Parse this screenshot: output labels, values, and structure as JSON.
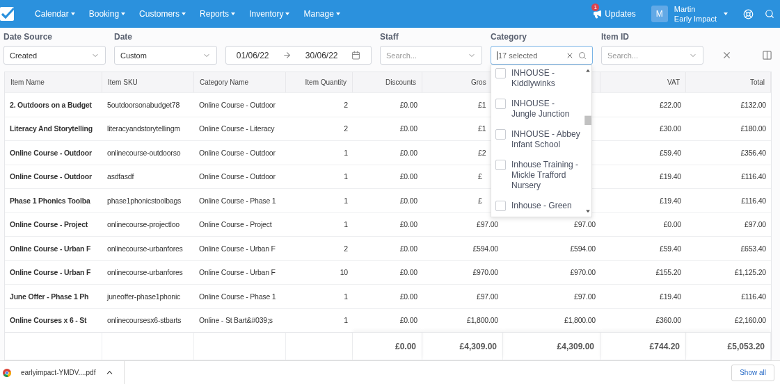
{
  "nav": {
    "menus": [
      "Calendar",
      "Booking",
      "Customers",
      "Reports",
      "Inventory",
      "Manage"
    ],
    "updates": {
      "label": "Updates",
      "badge": "1"
    },
    "user": {
      "avatar": "M",
      "name": "Martin",
      "org": "Early Impact"
    }
  },
  "filters": {
    "date_source": {
      "label": "Date Source",
      "value": "Created"
    },
    "date": {
      "label": "Date",
      "value": "Custom"
    },
    "range": {
      "from": "01/06/22",
      "to": "30/06/22"
    },
    "staff": {
      "label": "Staff",
      "placeholder": "Search..."
    },
    "category": {
      "label": "Category",
      "value": "17 selected",
      "options": [
        {
          "label": "INHOUSE - Kiddlywinks",
          "checked": false
        },
        {
          "label": "INHOUSE - Jungle Junction",
          "checked": false
        },
        {
          "label": "INHOUSE - Abbey Infant School",
          "checked": false
        },
        {
          "label": "Inhouse Training - Mickle Trafford Nursery",
          "checked": false
        },
        {
          "label": "Inhouse - Green",
          "checked": false
        }
      ]
    },
    "item_id": {
      "label": "Item ID",
      "placeholder": "Search..."
    }
  },
  "table": {
    "columns": [
      {
        "label": "Item Name",
        "covered": false
      },
      {
        "label": "Item SKU",
        "covered": false
      },
      {
        "label": "Category Name",
        "covered": false
      },
      {
        "label": "Item Quantity",
        "covered": false
      },
      {
        "label": "Discounts",
        "covered": false
      },
      {
        "label": "Gros",
        "covered": true
      },
      null,
      {
        "label": "VAT",
        "covered": false
      },
      {
        "label": "Total",
        "covered": false
      }
    ],
    "rows": [
      {
        "cells": [
          "2. Outdoors on a Budget",
          "5outdoorsonabudget78",
          "Online Course - Outdoor",
          "2",
          "£0.00",
          {
            "text": "£1",
            "covered": true
          },
          null,
          "£22.00",
          "£132.00"
        ]
      },
      {
        "cells": [
          "Literacy And Storytelling",
          "literacyandstorytellingm",
          "Online Course - Literacy",
          "2",
          "£0.00",
          {
            "text": "£1",
            "covered": true
          },
          null,
          "£30.00",
          "£180.00"
        ]
      },
      {
        "cells": [
          "Online Course - Outdoor",
          "onlinecourse-outdoorso",
          "Online Course - Outdoor",
          "1",
          "£0.00",
          {
            "text": "£2",
            "covered": true
          },
          null,
          "£59.40",
          "£356.40"
        ]
      },
      {
        "cells": [
          "Online Course - Outdoor",
          "asdfasdf",
          "Online Course - Outdoor",
          "1",
          "£0.00",
          {
            "text": "£",
            "covered": true
          },
          null,
          "£19.40",
          "£116.40"
        ]
      },
      {
        "cells": [
          "Phase 1 Phonics Toolba",
          "phase1phonicstoolbags",
          "Online Course - Phase 1",
          "1",
          "£0.00",
          {
            "text": "£",
            "covered": true
          },
          null,
          "£19.40",
          "£116.40"
        ]
      },
      {
        "cells": [
          "Online Course - Project",
          "onlinecourse-projectloo",
          "Online Course - Project",
          "1",
          "£0.00",
          {
            "text": "£97.00",
            "covered": false
          },
          "£97.00",
          "£0.00",
          "£97.00"
        ]
      },
      {
        "cells": [
          "Online Course - Urban F",
          "onlinecourse-urbanfores",
          "Online Course - Urban F",
          "2",
          "£0.00",
          {
            "text": "£594.00",
            "covered": false
          },
          "£594.00",
          "£59.40",
          "£653.40"
        ]
      },
      {
        "cells": [
          "Online Course - Urban F",
          "onlinecourse-urbanfores",
          "Online Course - Urban F",
          "10",
          "£0.00",
          {
            "text": "£970.00",
            "covered": false
          },
          "£970.00",
          "£155.20",
          "£1,125.20"
        ]
      },
      {
        "cells": [
          "June Offer - Phase 1 Ph",
          "juneoffer-phase1phonic",
          "Online Course - Phase 1",
          "1",
          "£0.00",
          {
            "text": "£97.00",
            "covered": false
          },
          "£97.00",
          "£19.40",
          "£116.40"
        ]
      },
      {
        "cells": [
          "Online Courses x 6 - St",
          "onlinecoursesx6-stbarts",
          "Online - St Bart&#039;s",
          "1",
          "£0.00",
          {
            "text": "£1,800.00",
            "covered": false
          },
          "£1,800.00",
          "£360.00",
          "£2,160.00"
        ]
      }
    ],
    "totals": [
      "£0.00",
      "£4,309.00",
      "£4,309.00",
      "£744.20",
      "£5,053.20"
    ]
  },
  "download_bar": {
    "file": "earlyimpact-YMDV....pdf",
    "button": "Show all"
  }
}
